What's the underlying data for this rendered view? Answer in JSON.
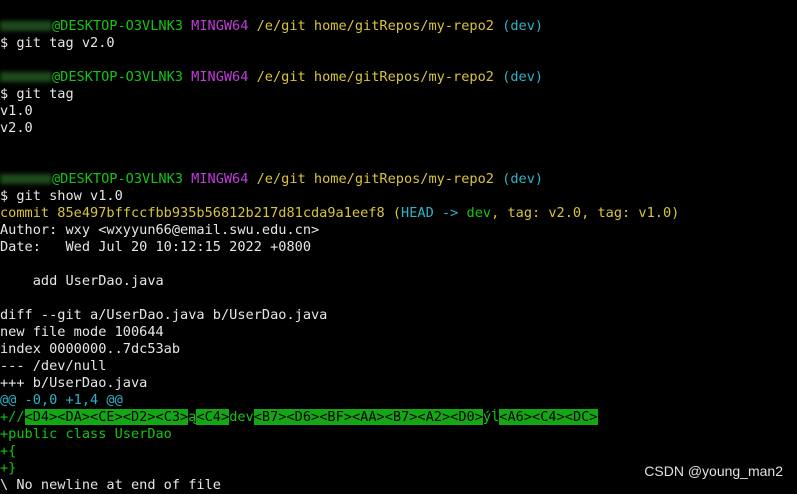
{
  "prompts": [
    {
      "user_suffix": "@DESKTOP-O3VLNK3",
      "system": "MINGW64",
      "path": "/e/git home/gitRepos/my-repo2",
      "branch": "(dev)"
    },
    {
      "user_suffix": "@DESKTOP-O3VLNK3",
      "system": "MINGW64",
      "path": "/e/git home/gitRepos/my-repo2",
      "branch": "(dev)"
    },
    {
      "user_suffix": "@DESKTOP-O3VLNK3",
      "system": "MINGW64",
      "path": "/e/git home/gitRepos/my-repo2",
      "branch": "(dev)"
    }
  ],
  "commands": [
    "$ git tag v2.0",
    "$ git tag",
    "$ git show v1.0"
  ],
  "tag_output": [
    "v1.0",
    "v2.0"
  ],
  "commit": {
    "hash_line": "commit 85e497bffccfbb935b56812b217d81cda9a1eef8",
    "refs": {
      "open": "(",
      "head": "HEAD -> ",
      "branch": "dev",
      "sep1": ", ",
      "tag1": "tag: v2.0",
      "sep2": ", ",
      "tag2": "tag: v1.0",
      "close": ")"
    },
    "author": "Author: wxy <wxyyun66@email.swu.edu.cn>",
    "date": "Date:   Wed Jul 20 10:12:15 2022 +0800",
    "message": "    add UserDao.java"
  },
  "diff": {
    "header": "diff --git a/UserDao.java b/UserDao.java",
    "mode": "new file mode 100644",
    "index": "index 0000000..7dc53ab",
    "minus_file": "--- /dev/null",
    "plus_file": "+++ b/UserDao.java",
    "hunk": "@@ -0,0 +1,4 @@",
    "added_line_1": {
      "prefix": "+//",
      "hl1": "<D4><DA><CE><D2><C3>",
      "mid1": "ą",
      "hl2": "<C4>",
      "mid2": "dev",
      "hl3": "<B7><D6><BF><AA><B7><A2><D0>",
      "mid3": "ýĺ",
      "hl4": "<A6><C4><DC>"
    },
    "added_line_2": "+public class UserDao",
    "added_line_3": "+{",
    "added_line_4": "+}",
    "no_newline": "\\ No newline at end of file"
  },
  "watermark": "CSDN @young_man2",
  "colors": {
    "user": "#13c613",
    "system": "#c13bd9",
    "path": "#d8c43a",
    "branch": "#2fb3c7",
    "hunk": "#2fb3c7",
    "added": "#13c613",
    "highlight_bg": "#13a813"
  }
}
